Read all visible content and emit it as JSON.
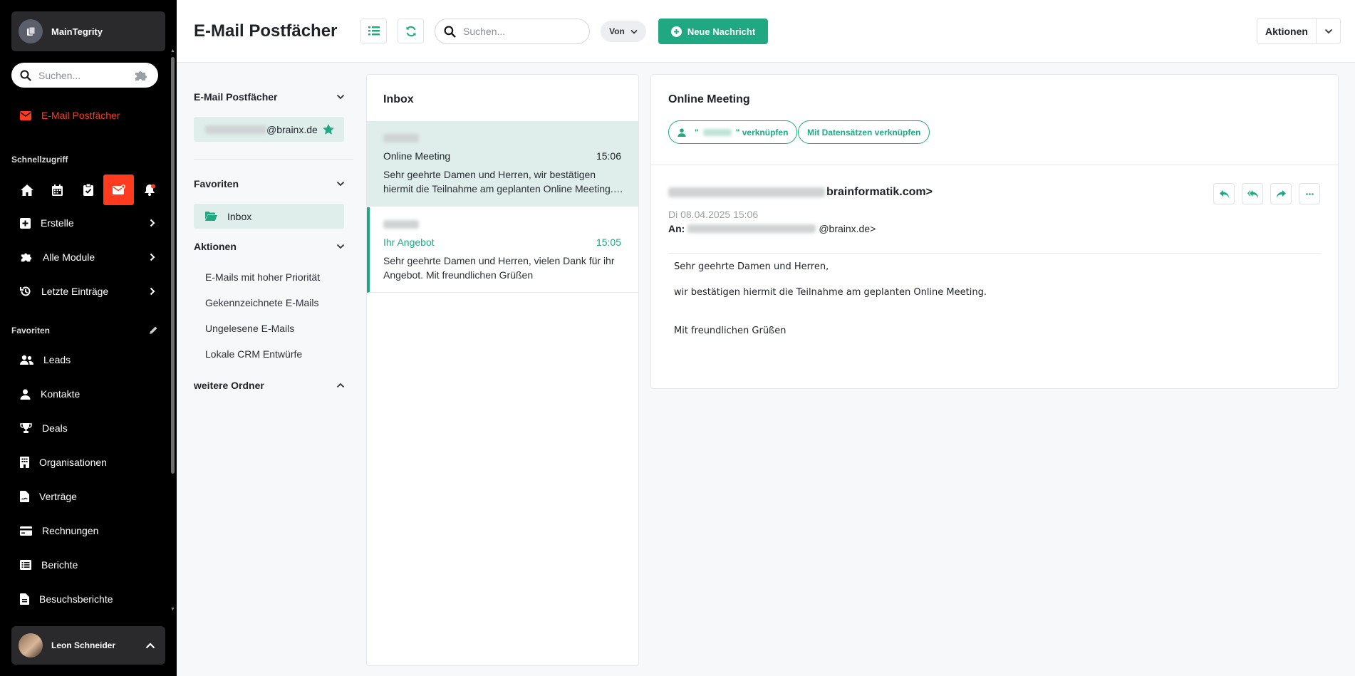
{
  "app": {
    "name": "MainTegrity"
  },
  "sidebar": {
    "search_placeholder": "Suchen...",
    "active_item": "E-Mail Postfächer",
    "quick_access_label": "Schnellzugriff",
    "menu": [
      {
        "label": "Erstelle"
      },
      {
        "label": "Alle Module"
      },
      {
        "label": "Letzte Einträge"
      }
    ],
    "favorites_label": "Favoriten",
    "favorites": [
      {
        "label": "Leads",
        "icon": "users-icon"
      },
      {
        "label": "Kontakte",
        "icon": "user-icon"
      },
      {
        "label": "Deals",
        "icon": "trophy-icon"
      },
      {
        "label": "Organisationen",
        "icon": "building-icon"
      },
      {
        "label": "Verträge",
        "icon": "contract-icon"
      },
      {
        "label": "Rechnungen",
        "icon": "credit-card-icon"
      },
      {
        "label": "Berichte",
        "icon": "report-icon"
      },
      {
        "label": "Besuchsberichte",
        "icon": "document-icon"
      }
    ],
    "user": {
      "name": "Leon Schneider"
    }
  },
  "header": {
    "title": "E-Mail Postfächer",
    "search_placeholder": "Suchen...",
    "von_label": "Von",
    "new_message_label": "Neue Nachricht",
    "actions_label": "Aktionen"
  },
  "folders": {
    "mailboxes_label": "E-Mail Postfächer",
    "mailbox_domain": "@brainx.de",
    "favorites_label": "Favoriten",
    "inbox_label": "Inbox",
    "actions_label": "Aktionen",
    "actions": [
      "E-Mails mit hoher Priorität",
      "Gekennzeichnete E-Mails",
      "Ungelesene E-Mails",
      "Lokale CRM Entwürfe"
    ],
    "more_folders_label": "weitere Ordner"
  },
  "message_list": {
    "title": "Inbox",
    "messages": [
      {
        "subject": "Online Meeting",
        "time": "15:06",
        "preview": "Sehr geehrte Damen und Herren, wir bestätigen hiermit die Teilnahme am geplanten Online Meeting. Mit freundlichen Grüßen"
      },
      {
        "subject": "Ihr Angebot",
        "time": "15:05",
        "preview": "Sehr geehrte Damen und Herren, vielen Dank für ihr Angebot. Mit freundlichen Grüßen"
      }
    ]
  },
  "detail": {
    "subject": "Online Meeting",
    "link_contact_suffix": "\" verknüpfen",
    "link_contact_prefix": "\"",
    "link_records_label": "Mit Datensätzen verknüpfen",
    "from_suffix": "brainformatik.com>",
    "date": "Di 08.04.2025 15:06",
    "to_label": "An:",
    "to_suffix": "@brainx.de>",
    "body": [
      "Sehr geehrte Damen und Herren,",
      "wir bestätigen hiermit die Teilnahme am geplanten Online Meeting.",
      "Mit freundlichen Grüßen"
    ]
  },
  "colors": {
    "accent": "#1fa882",
    "active_nav": "#ff3b1f",
    "sidebar_bg": "#000000"
  }
}
